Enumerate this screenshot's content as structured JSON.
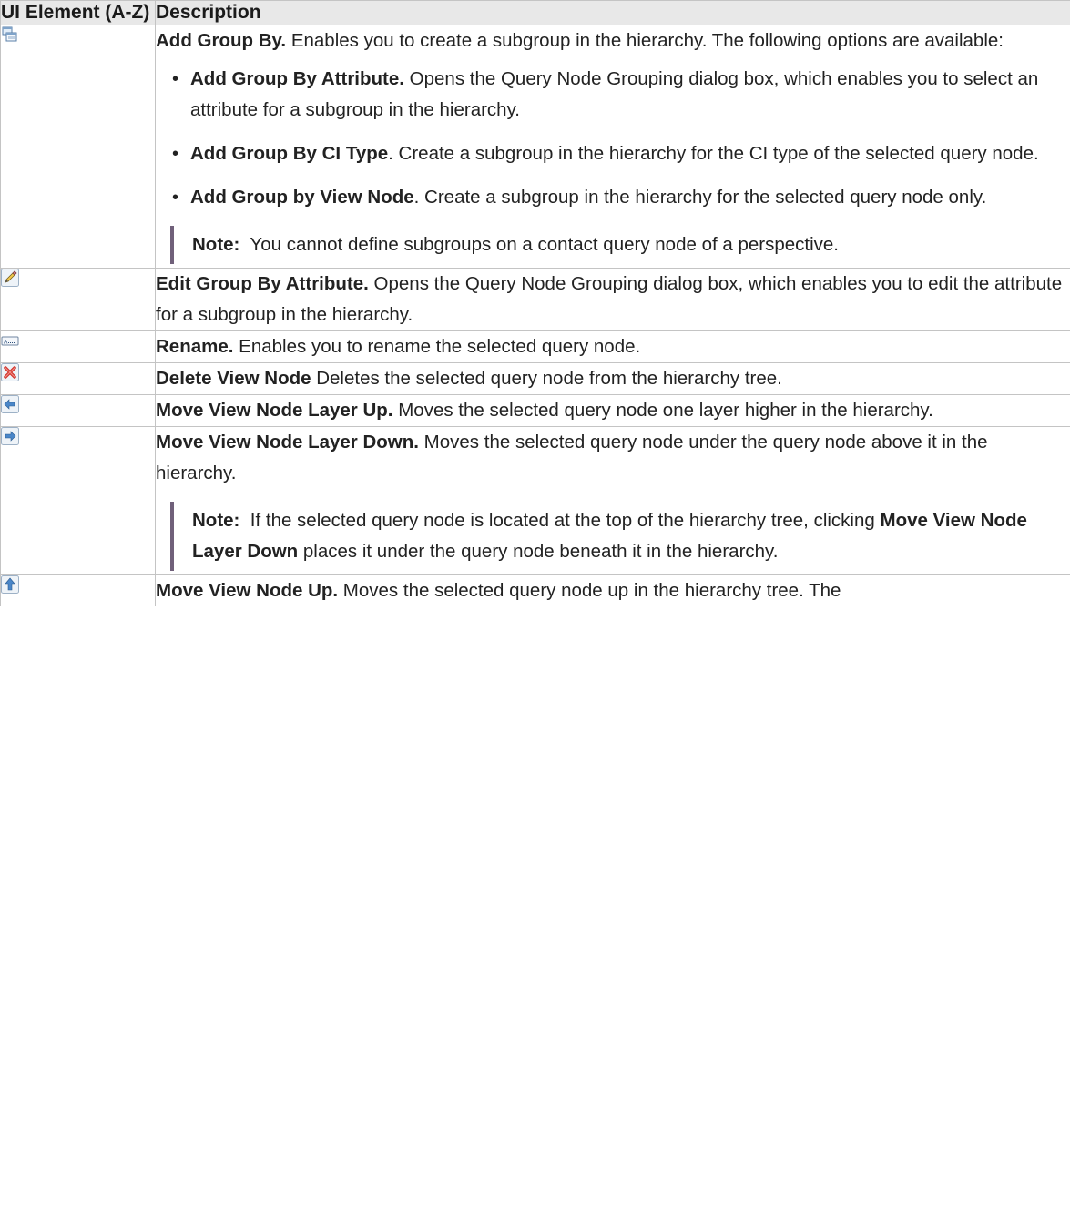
{
  "header": {
    "ui_element": "UI Element (A-Z)",
    "description": "Description"
  },
  "rows": [
    {
      "icon": "add-group-by-icon",
      "title": "Add Group By.",
      "text": " Enables you to create a subgroup in the hierarchy. The following options are available:",
      "options": [
        {
          "title": "Add Group By Attribute.",
          "text": " Opens the Query Node Grouping dialog box, which enables you to select an attribute for a subgroup in the hierarchy."
        },
        {
          "title": "Add Group By CI Type",
          "text": ". Create a subgroup in the hierarchy for the CI type of the selected query node."
        },
        {
          "title": "Add Group by View Node",
          "text": ". Create a subgroup in the hierarchy for the selected query node only."
        }
      ],
      "note_label": "Note:",
      "note_text": "  You cannot define subgroups on a contact query node of a perspective."
    },
    {
      "icon": "edit-pencil-icon",
      "title": "Edit Group By Attribute.",
      "text": " Opens the Query Node Grouping dialog box, which enables you to edit the attribute for a subgroup in the hierarchy."
    },
    {
      "icon": "rename-icon",
      "title": "Rename.",
      "text": " Enables you to rename the selected query node."
    },
    {
      "icon": "delete-x-icon",
      "title": "Delete View Node",
      "text": " Deletes the selected query node from the hierarchy tree."
    },
    {
      "icon": "arrow-left-icon",
      "title": "Move View Node Layer Up.",
      "text": " Moves the selected query node one layer higher in the hierarchy."
    },
    {
      "icon": "arrow-right-icon",
      "title": "Move View Node Layer Down.",
      "text": " Moves the selected query node under the query node above it in the hierarchy.",
      "note_label": "Note:",
      "note_text_1": "  If the selected query node is located at the top of the hierarchy tree, clicking ",
      "note_bold": "Move View Node Layer Down",
      "note_text_2": " places it under the query node beneath it in the hierarchy."
    },
    {
      "icon": "move-up-icon",
      "title": "Move View Node Up.",
      "text": " Moves the selected query node up in the hierarchy tree. The"
    }
  ]
}
